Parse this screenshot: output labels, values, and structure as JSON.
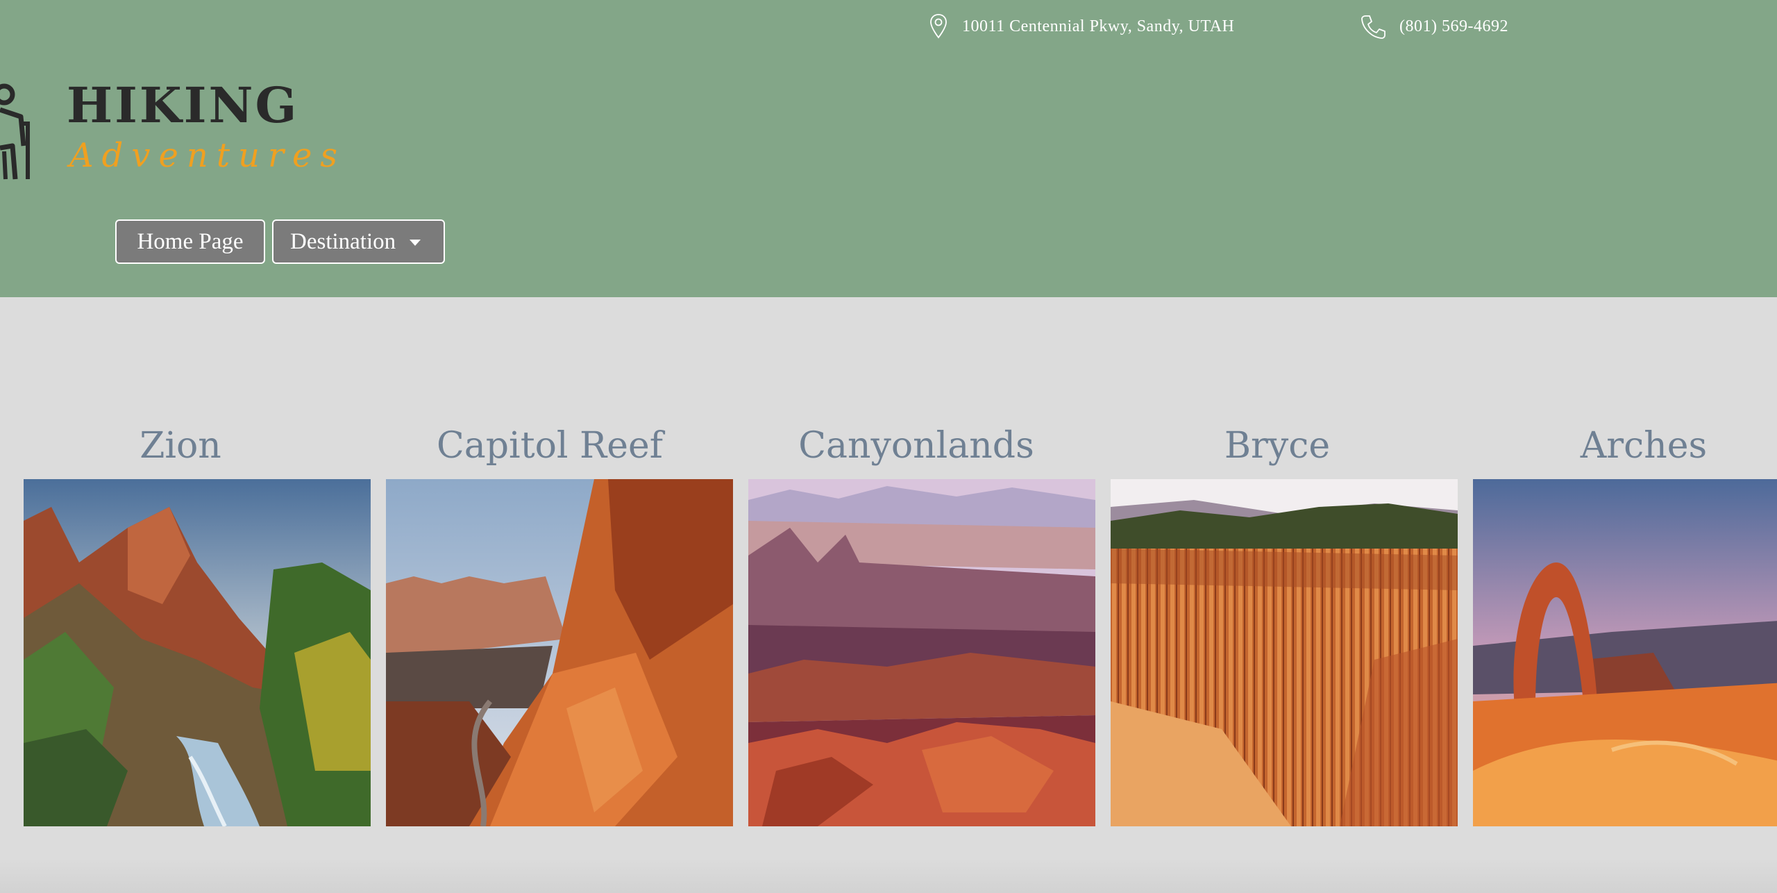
{
  "header": {
    "address": "10011 Centennial Pkwy, Sandy, UTAH",
    "phone": "(801) 569-4692",
    "logo_title": "HIKING",
    "logo_subtitle": "Adventures",
    "icons": [
      "map-pin-icon",
      "phone-icon",
      "hiker-logo-icon"
    ]
  },
  "nav": {
    "home_label": "Home Page",
    "destination_label": "Destination"
  },
  "destinations": [
    {
      "name": "Zion"
    },
    {
      "name": "Capitol Reef"
    },
    {
      "name": "Canyonlands"
    },
    {
      "name": "Bryce"
    },
    {
      "name": "Arches"
    }
  ],
  "colors": {
    "header_bg": "#83a688",
    "page_bg": "#dcdcdc",
    "title_color": "#6f8093",
    "button_bg": "#7b7b7b",
    "logo_accent": "#f0a020"
  }
}
